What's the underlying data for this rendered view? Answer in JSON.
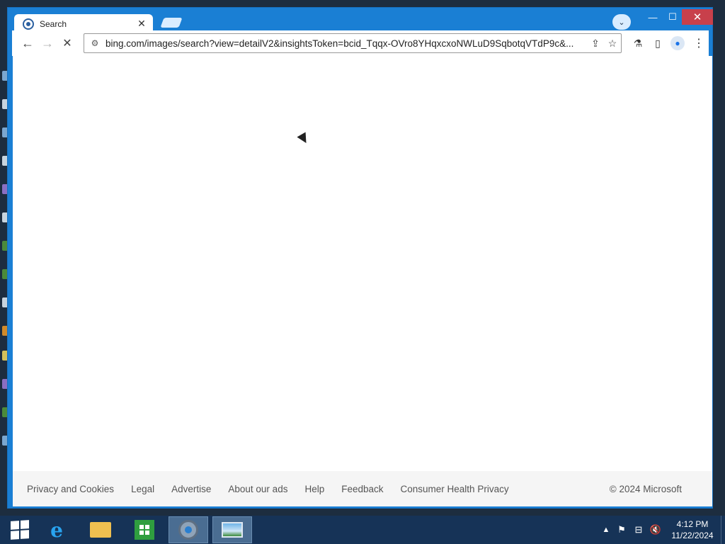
{
  "browser": {
    "tab": {
      "title": "Search"
    },
    "omnibox": {
      "url": "bing.com/images/search?view=detailV2&insightsToken=bcid_Tqqx-OVro8YHqxcxoNWLuD9SqbotqVTdP9c&..."
    }
  },
  "footer": {
    "links": [
      "Privacy and Cookies",
      "Legal",
      "Advertise",
      "About our ads",
      "Help",
      "Feedback",
      "Consumer Health Privacy"
    ],
    "copyright": "© 2024 Microsoft"
  },
  "taskbar": {
    "clock": {
      "time": "4:12 PM",
      "date": "11/22/2024"
    }
  },
  "icons": {
    "back": "arrow-left-icon",
    "forward": "arrow-right-icon",
    "stop": "stop-loading-icon",
    "share": "share-icon",
    "star": "bookmark-star-icon",
    "lab": "flask-icon",
    "side": "side-panel-icon",
    "profile": "profile-avatar-icon",
    "menu": "more-vert-icon"
  },
  "colors": {
    "window_accent": "#1a7fd4",
    "taskbar": "#163357",
    "close": "#c8404b"
  }
}
